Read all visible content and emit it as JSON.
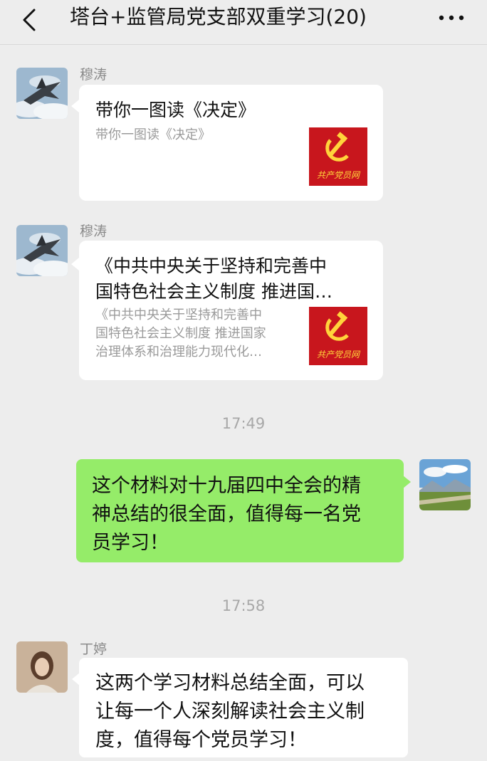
{
  "header": {
    "title": "塔台+监管局党支部双重学习(20)"
  },
  "messages": [
    {
      "sender": "穆涛",
      "card_title": "带你一图读《决定》",
      "card_desc": "带你一图读《决定》",
      "thumb_text": "共产党员网"
    },
    {
      "sender": "穆涛",
      "card_title_line1": "《中共中央关于坚持和完善中",
      "card_title_line2": "国特色社会主义制度 推进国…",
      "card_desc_line1": "《中共中央关于坚持和完善中",
      "card_desc_line2": "国特色社会主义制度 推进国家",
      "card_desc_line3": "治理体系和治理能力现代化…",
      "thumb_text": "共产党员网"
    },
    {
      "time": "17:49",
      "line1": "这个材料对十九届四中全会的精",
      "line2": "神总结的很全面，值得每一名党",
      "line3": "员学习！"
    },
    {
      "time": "17:58",
      "sender": "丁婷",
      "line1": "这两个学习材料总结全面，可以",
      "line2": "让每一个人深刻解读社会主义制",
      "line3": "度，值得每个党员学习！"
    }
  ],
  "colors": {
    "background": "#ededed",
    "self_bubble": "#95ec69",
    "other_bubble": "#ffffff",
    "party_red": "#c8161d"
  }
}
